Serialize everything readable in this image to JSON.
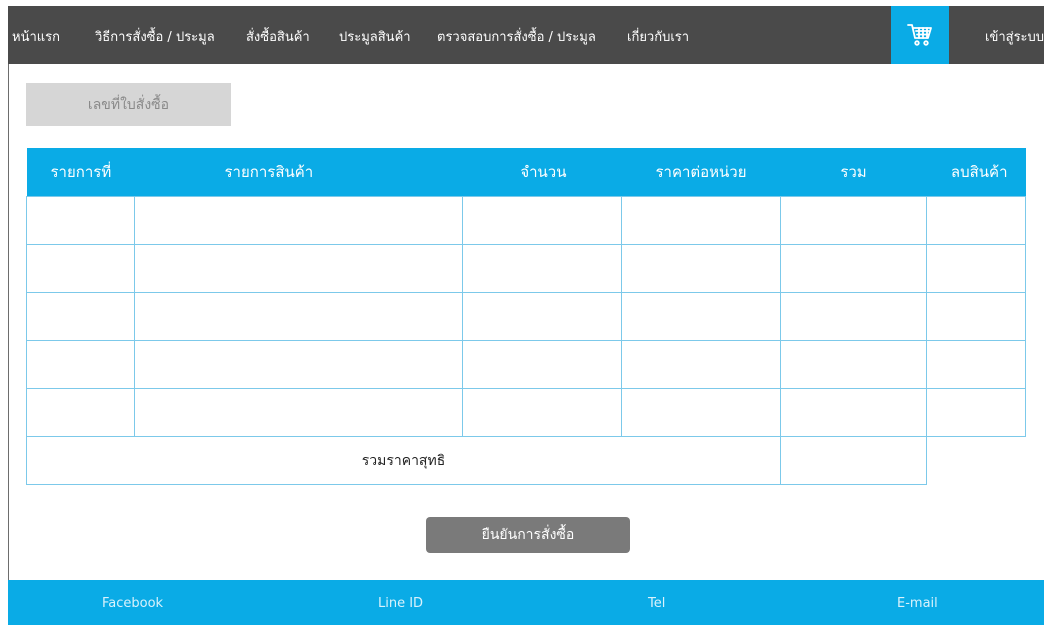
{
  "nav": {
    "items": [
      {
        "label": "หน้าแรก"
      },
      {
        "label": "วิธีการสั่งซื้อ / ประมูล"
      },
      {
        "label": "สั่งซื้อสินค้า"
      },
      {
        "label": "ประมูลสินค้า"
      },
      {
        "label": "ตรวจสอบการสั่งซื้อ / ประมูล"
      },
      {
        "label": "เกี่ยวกับเรา"
      }
    ],
    "login_label": "เข้าสู่ระบบ",
    "cart_icon": "shopping-cart-icon"
  },
  "order_no": {
    "label": "เลขที่ใบสั่งซื้อ"
  },
  "table": {
    "headers": [
      "รายการที่",
      "รายการสินค้า",
      "จำนวน",
      "ราคาต่อหน่วย",
      "รวม",
      "ลบสินค้า"
    ],
    "rows": [
      [
        "",
        "",
        "",
        "",
        "",
        ""
      ],
      [
        "",
        "",
        "",
        "",
        "",
        ""
      ],
      [
        "",
        "",
        "",
        "",
        "",
        ""
      ],
      [
        "",
        "",
        "",
        "",
        "",
        ""
      ],
      [
        "",
        "",
        "",
        "",
        "",
        ""
      ]
    ],
    "total_label": "รวมราคาสุทธิ",
    "total_value": ""
  },
  "confirm_button": {
    "label": "ยืนยันการสั่งซื้อ"
  },
  "footer": {
    "links": [
      {
        "label": "Facebook"
      },
      {
        "label": "Line ID"
      },
      {
        "label": "Tel"
      },
      {
        "label": "E-mail"
      }
    ]
  },
  "colors": {
    "nav_bg": "#4a4a4a",
    "accent": "#0aabe6",
    "button_gray": "#7a7a7a",
    "order_no_bg": "#d6d6d6"
  }
}
